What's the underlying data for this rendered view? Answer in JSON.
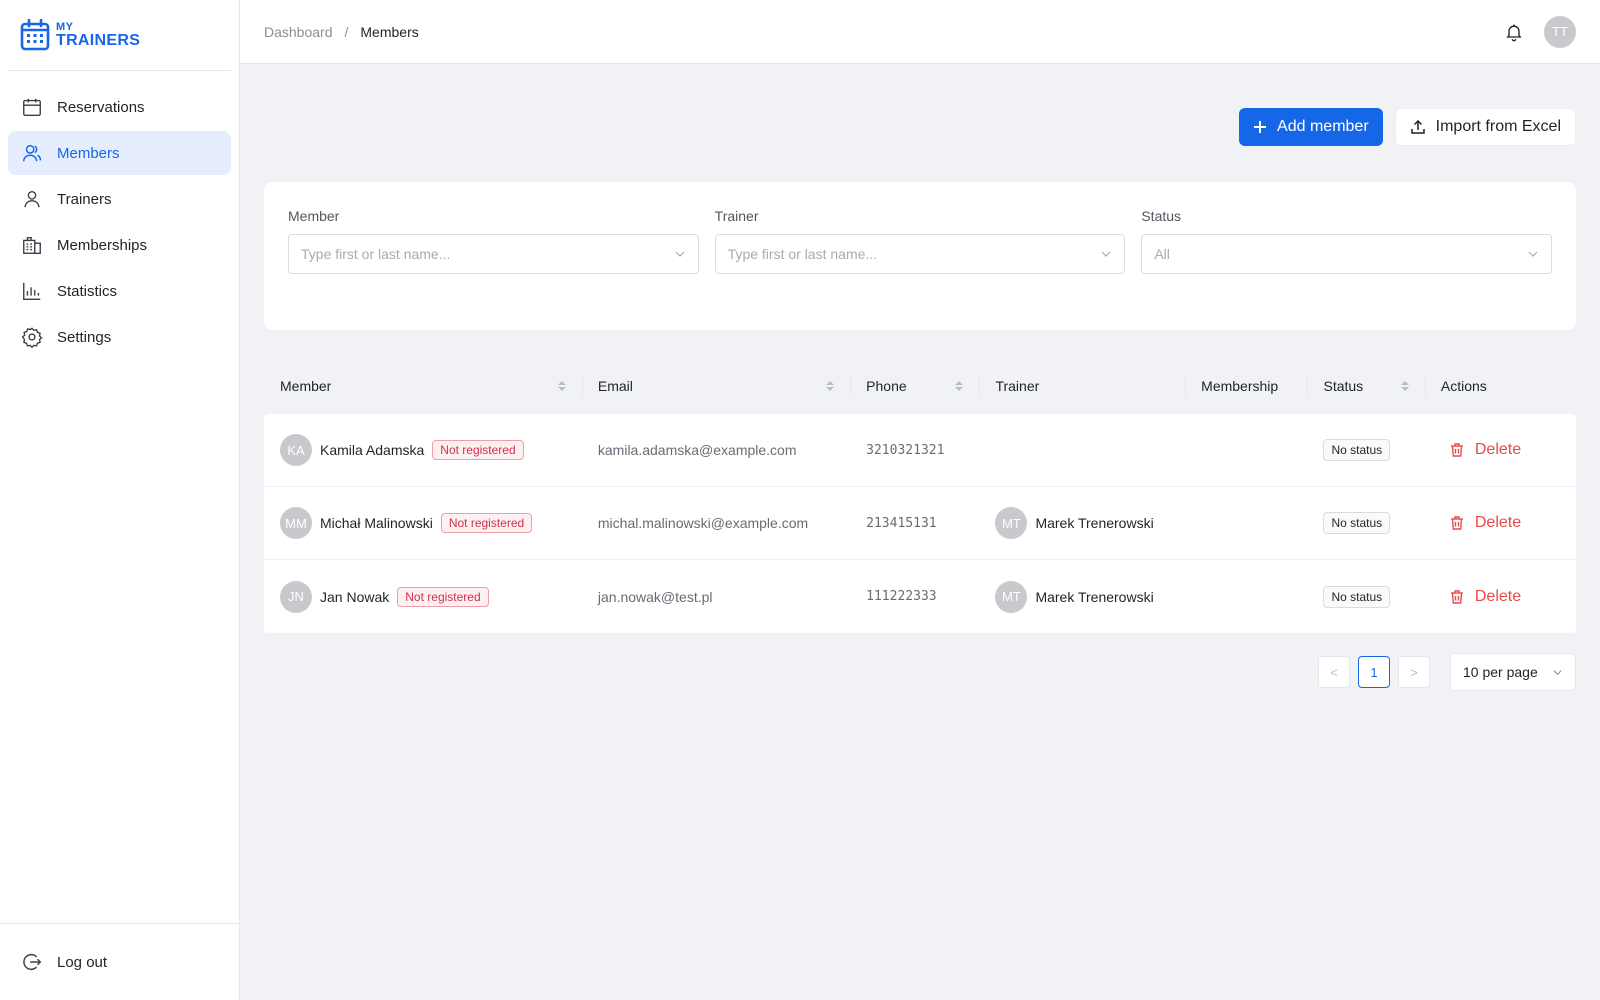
{
  "brand": {
    "line1": "MY",
    "line2": "TRAINERS",
    "accent": "#1667e8"
  },
  "sidebar": {
    "items": [
      {
        "label": "Reservations",
        "icon": "calendar-icon"
      },
      {
        "label": "Members",
        "icon": "members-icon",
        "active": true
      },
      {
        "label": "Trainers",
        "icon": "user-icon"
      },
      {
        "label": "Memberships",
        "icon": "membership-card-icon"
      },
      {
        "label": "Statistics",
        "icon": "bar-chart-icon"
      },
      {
        "label": "Settings",
        "icon": "gear-icon"
      }
    ],
    "logout": "Log out"
  },
  "topbar": {
    "breadcrumb": {
      "parent": "Dashboard",
      "separator": "/",
      "current": "Members"
    },
    "user_initials": "TT"
  },
  "actions": {
    "add_member": "Add member",
    "import_excel": "Import from Excel"
  },
  "filters": {
    "member": {
      "label": "Member",
      "placeholder": "Type first or last name..."
    },
    "trainer": {
      "label": "Trainer",
      "placeholder": "Type first or last name..."
    },
    "status": {
      "label": "Status",
      "value": "All"
    }
  },
  "table": {
    "columns": [
      "Member",
      "Email",
      "Phone",
      "Trainer",
      "Membership",
      "Status",
      "Actions"
    ],
    "rows": [
      {
        "initials": "KA",
        "name": "Kamila Adamska",
        "badge": "Not registered",
        "email": "kamila.adamska@example.com",
        "phone": "3210321321",
        "trainer_initials": "",
        "trainer": "",
        "membership": "",
        "status": "No status",
        "action": "Delete"
      },
      {
        "initials": "MM",
        "name": "Michał Malinowski",
        "badge": "Not registered",
        "email": "michal.malinowski@example.com",
        "phone": "213415131",
        "trainer_initials": "MT",
        "trainer": "Marek Trenerowski",
        "membership": "",
        "status": "No status",
        "action": "Delete"
      },
      {
        "initials": "JN",
        "name": "Jan Nowak",
        "badge": "Not registered",
        "email": "jan.nowak@test.pl",
        "phone": "111222333",
        "trainer_initials": "MT",
        "trainer": "Marek Trenerowski",
        "membership": "",
        "status": "No status",
        "action": "Delete"
      }
    ]
  },
  "pagination": {
    "current_page": "1",
    "prev": "<",
    "next": ">",
    "per_page": "10 per page"
  }
}
